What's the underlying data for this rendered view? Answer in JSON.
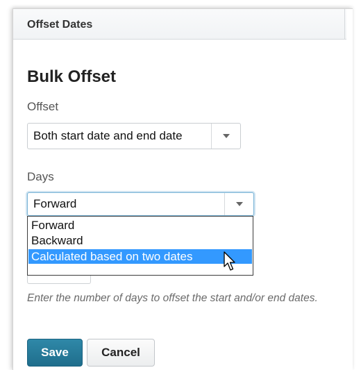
{
  "panel": {
    "title": "Offset Dates"
  },
  "form": {
    "heading": "Bulk Offset",
    "offset": {
      "label": "Offset",
      "selected": "Both start date and end date"
    },
    "days": {
      "label": "Days",
      "selected": "Forward",
      "options": [
        "Forward",
        "Backward",
        "Calculated based on two dates"
      ],
      "highlighted_index": 2
    },
    "hint": "Enter the number of days to offset the start and/or end dates.",
    "save_label": "Save",
    "cancel_label": "Cancel"
  },
  "colors": {
    "primary_button": "#1f6e8c",
    "highlight": "#3399ff",
    "focus_ring": "#78b3d6"
  },
  "icons": {
    "dropdown": "chevron-down-icon",
    "cursor": "mouse-pointer-icon"
  }
}
